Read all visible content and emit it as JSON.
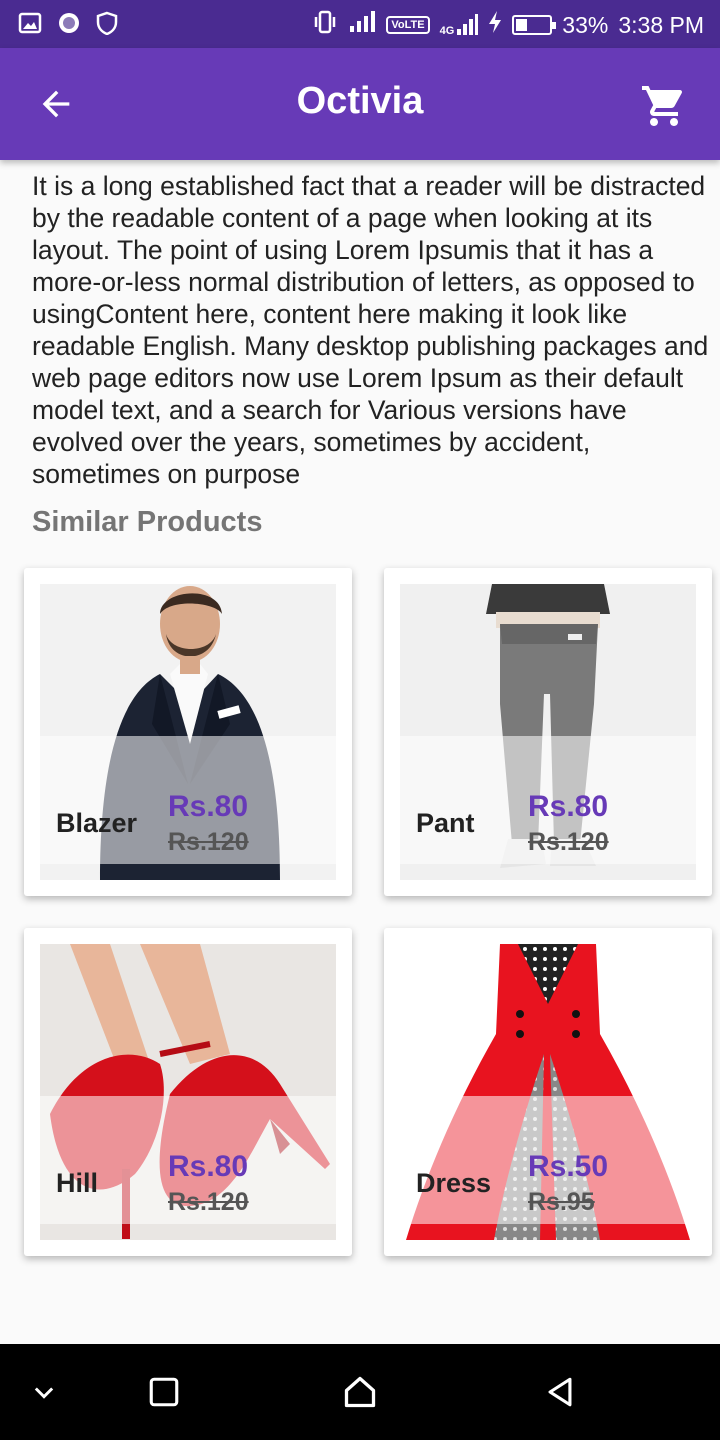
{
  "status_bar": {
    "volte": "VoLTE",
    "network": "4G",
    "battery": "33%",
    "battery_level": 0.33,
    "time": "3:38 PM",
    "icons": [
      "image-icon",
      "circle-icon",
      "shield-icon",
      "vibrate-icon",
      "signal-icon",
      "charging-icon",
      "battery-icon"
    ]
  },
  "app_bar": {
    "title": "Octivia",
    "back_icon": "arrow-back-icon",
    "cart_icon": "shopping-cart-icon"
  },
  "description": "It is a long established fact that a reader will be distracted by the readable content of a page when looking at its layout. The point of using Lorem Ipsumis that it has a more-or-less normal distribution of letters, as opposed to usingContent here, content here making it look like readable English. Many desktop publishing packages and web page editors now use Lorem Ipsum as their default model text, and a search for Various versions have evolved over the years, sometimes by accident, sometimes on purpose",
  "similar": {
    "title": "Similar Products",
    "products": [
      {
        "name": "Blazer",
        "price": "Rs.80",
        "old_price": "Rs.120"
      },
      {
        "name": "Pant",
        "price": "Rs.80",
        "old_price": "Rs.120"
      },
      {
        "name": "Hill",
        "price": "Rs.80",
        "old_price": "Rs.120"
      },
      {
        "name": "Dress",
        "price": "Rs.50",
        "old_price": "Rs.95"
      }
    ]
  },
  "colors": {
    "primary": "#673ab7",
    "status_bar": "#4a2b91",
    "price": "#673ab7"
  },
  "nav_bar": {
    "icons": [
      "chevron-down-icon",
      "recents-icon",
      "home-icon",
      "back-triangle-icon"
    ]
  }
}
